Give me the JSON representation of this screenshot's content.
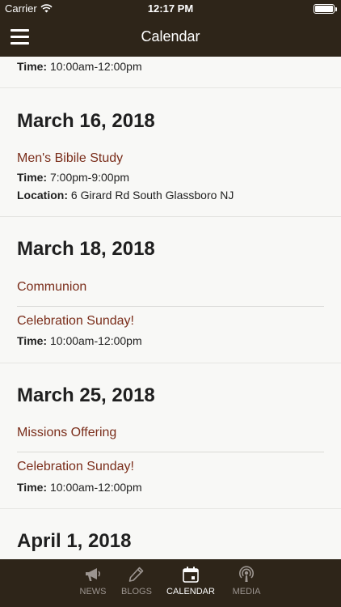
{
  "status_bar": {
    "carrier": "Carrier",
    "time": "12:17 PM"
  },
  "nav": {
    "title": "Calendar"
  },
  "top_fragment": {
    "time_label": "Time:",
    "time_value": "10:00am-12:00pm"
  },
  "sections": [
    {
      "date": "March 16, 2018",
      "events": [
        {
          "title": "Men's Bibile Study",
          "time_label": "Time:",
          "time": "7:00pm-9:00pm",
          "location_label": "Location:",
          "location": "6 Girard Rd South Glassboro NJ"
        }
      ]
    },
    {
      "date": "March 18, 2018",
      "events": [
        {
          "title": "Communion"
        },
        {
          "title": "Celebration Sunday!",
          "time_label": "Time:",
          "time": "10:00am-12:00pm"
        }
      ]
    },
    {
      "date": "March 25, 2018",
      "events": [
        {
          "title": "Missions Offering"
        },
        {
          "title": "Celebration Sunday!",
          "time_label": "Time:",
          "time": "10:00am-12:00pm"
        }
      ]
    },
    {
      "date": "April 1, 2018",
      "events": []
    }
  ],
  "tabs": [
    {
      "label": "NEWS",
      "icon": "megaphone-icon",
      "active": false
    },
    {
      "label": "BLOGS",
      "icon": "pencil-icon",
      "active": false
    },
    {
      "label": "CALENDAR",
      "icon": "calendar-icon",
      "active": true
    },
    {
      "label": "MEDIA",
      "icon": "podcast-icon",
      "active": false
    }
  ],
  "colors": {
    "bar": "#2e2519",
    "event_title": "#7a2d1a",
    "background": "#f8f8f6"
  }
}
